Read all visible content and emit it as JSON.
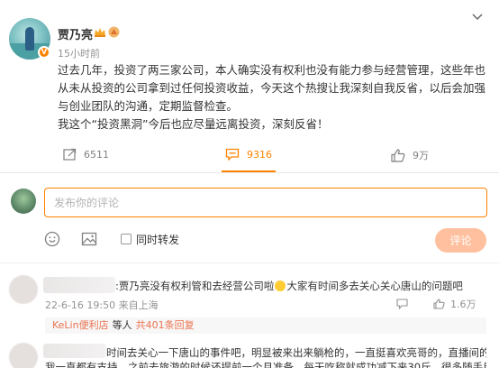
{
  "post": {
    "username": "贾乃亮",
    "time": "15小时前",
    "paragraphs": [
      "过去几年，投资了两三家公司，本人确实没有权利也没有能力参与经营管理，这些年也从未从投资的公司拿到过任何投资收益，今天这个热搜让我深刻自我反省，以后会加强与创业团队的沟通，定期监督检查。",
      "我这个“投资黑洞”今后也应尽量远离投资，深刻反省！"
    ]
  },
  "actions": {
    "repost_count": "6511",
    "comment_count": "9316",
    "like_count": "9万"
  },
  "composer": {
    "placeholder": "发布你的评论",
    "repost_label": "同时转发",
    "submit_label": "评论"
  },
  "comments": [
    {
      "text_before": ":贾乃亮没有权利管和去经营公司啦",
      "text_after": "大家有时间多去关心关心唐山的问题吧",
      "date": "22-6-16 19:50",
      "location": "来自上海",
      "like_count": "1.6万",
      "reply": {
        "user": "KeLin便利店",
        "etc": "等人",
        "count_text": "共401条回复"
      }
    },
    {
      "line1": "时间去关心一下唐山的事件吧，明显被来出来躺枪的，一直挺喜欢亮哥的，直播间的产品",
      "line2": "我一直都有支持，之前去旅游的时候还提前一个月准备，每天吃称就成功减下来30斤，很多随手用品都"
    }
  ],
  "icons": {
    "more": "chevron-down-icon",
    "repost": "repost-icon",
    "comment": "comment-icon",
    "like": "thumbs-up-icon",
    "emoji": "emoji-icon",
    "image": "image-icon",
    "reply": "reply-icon"
  },
  "colors": {
    "accent": "#ff8200",
    "submit_disabled": "#ffc09f",
    "reply_link": "#eb7350"
  }
}
